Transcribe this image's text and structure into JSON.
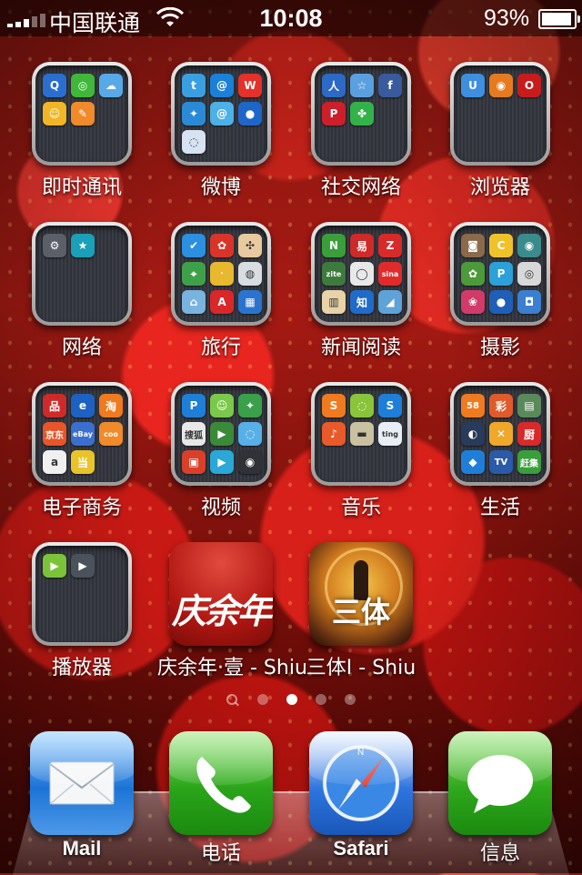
{
  "status_bar": {
    "carrier": "中国联通",
    "time": "10:08",
    "battery_percent": "93",
    "battery_pct_symbol": "%",
    "battery_level": 0.93
  },
  "folders": [
    {
      "label": "即时通讯",
      "icons": [
        {
          "name": "qq-icon",
          "glyph": "Q",
          "color": "#2a6fd0"
        },
        {
          "name": "wechat-icon",
          "glyph": "◎",
          "color": "#3fb83a"
        },
        {
          "name": "cloud-icon",
          "glyph": "☁",
          "color": "#58a9e8"
        },
        {
          "name": "chat-bubble-icon",
          "glyph": "☺",
          "color": "#f2b526"
        },
        {
          "name": "fetion-icon",
          "glyph": "✎",
          "color": "#f08a2a"
        }
      ]
    },
    {
      "label": "微博",
      "icons": [
        {
          "name": "twitter-icon",
          "glyph": "t",
          "color": "#3a9fe0"
        },
        {
          "name": "weibo-spiral-icon",
          "glyph": "@",
          "color": "#1b80d8"
        },
        {
          "name": "sina-weibo-icon",
          "glyph": "W",
          "color": "#e5312a"
        },
        {
          "name": "bird-icon",
          "glyph": "✦",
          "color": "#2b8ad6"
        },
        {
          "name": "at-icon",
          "glyph": "@",
          "color": "#4db0e8"
        },
        {
          "name": "blue-bird-icon",
          "glyph": "●",
          "color": "#1f66c9"
        },
        {
          "name": "bubble-icon",
          "glyph": "◌",
          "color": "#d7e2f2"
        }
      ]
    },
    {
      "label": "社交网络",
      "icons": [
        {
          "name": "renren-icon",
          "glyph": "人",
          "color": "#2d69c6"
        },
        {
          "name": "kaixin-icon",
          "glyph": "☆",
          "color": "#5aa0e0"
        },
        {
          "name": "facebook-icon",
          "glyph": "f",
          "color": "#3a5a9e"
        },
        {
          "name": "pinterest-icon",
          "glyph": "P",
          "color": "#cc1f2a"
        },
        {
          "name": "clover-icon",
          "glyph": "✤",
          "color": "#33b24a"
        }
      ]
    },
    {
      "label": "浏览器",
      "icons": [
        {
          "name": "uc-browser-icon",
          "glyph": "U",
          "color": "#3f8fe0"
        },
        {
          "name": "firefox-icon",
          "glyph": "◉",
          "color": "#e57a1f"
        },
        {
          "name": "opera-icon",
          "glyph": "O",
          "color": "#c81c1c"
        }
      ]
    },
    {
      "label": "网络",
      "icons": [
        {
          "name": "settings-icon",
          "glyph": "⚙",
          "color": "#5a5f68"
        },
        {
          "name": "star-app-icon",
          "glyph": "★",
          "color": "#1aa0b8"
        }
      ]
    },
    {
      "label": "旅行",
      "icons": [
        {
          "name": "checkin-icon",
          "glyph": "✔",
          "color": "#2c8fe0"
        },
        {
          "name": "ladybug-icon",
          "glyph": "✿",
          "color": "#d9342a"
        },
        {
          "name": "compass-icon",
          "glyph": "✣",
          "color": "#e8c9a0"
        },
        {
          "name": "map-pin-icon",
          "glyph": "⌖",
          "color": "#3fa04a"
        },
        {
          "name": "people-icon",
          "glyph": "ᐧ",
          "color": "#e8b830"
        },
        {
          "name": "elephant-icon",
          "glyph": "◍",
          "color": "#d8dde2"
        },
        {
          "name": "maps-icon",
          "glyph": "⌂",
          "color": "#79b3e0"
        },
        {
          "name": "alipay-a-icon",
          "glyph": "A",
          "color": "#d9282a"
        },
        {
          "name": "grid-app-icon",
          "glyph": "▦",
          "color": "#2a74d0"
        }
      ]
    },
    {
      "label": "新闻阅读",
      "icons": [
        {
          "name": "news-n-icon",
          "glyph": "N",
          "color": "#3a9e3a"
        },
        {
          "name": "netease-icon",
          "glyph": "易",
          "color": "#cf2a2a"
        },
        {
          "name": "zaker-icon",
          "glyph": "Z",
          "color": "#d92a2a"
        },
        {
          "name": "zite-icon",
          "glyph": "zite",
          "color": "#3e7a3e"
        },
        {
          "name": "sohu-icon",
          "glyph": "◯",
          "color": "#e8e8e8"
        },
        {
          "name": "sina-news-icon",
          "glyph": "sina",
          "color": "#e12b2b"
        },
        {
          "name": "book-icon",
          "glyph": "▥",
          "color": "#e8d2a8"
        },
        {
          "name": "zhihu-icon",
          "glyph": "知",
          "color": "#1f6bc9"
        },
        {
          "name": "shark-icon",
          "glyph": "◢",
          "color": "#5ea3d8"
        }
      ]
    },
    {
      "label": "摄影",
      "icons": [
        {
          "name": "instagram-icon",
          "glyph": "◙",
          "color": "#8a6a4a"
        },
        {
          "name": "paint-icon",
          "glyph": "C",
          "color": "#f0c22a"
        },
        {
          "name": "lens-icon",
          "glyph": "◉",
          "color": "#3a8c8c"
        },
        {
          "name": "flower-icon",
          "glyph": "✿",
          "color": "#4c9a3a"
        },
        {
          "name": "p-camera-icon",
          "glyph": "P",
          "color": "#2ca0d8"
        },
        {
          "name": "camera-icon",
          "glyph": "◎",
          "color": "#d8d8d8"
        },
        {
          "name": "petals-icon",
          "glyph": "❀",
          "color": "#d23a6a"
        },
        {
          "name": "video-camera-icon",
          "glyph": "●",
          "color": "#1f5fb8"
        },
        {
          "name": "snapshot-icon",
          "glyph": "◘",
          "color": "#3a7fd0"
        }
      ]
    },
    {
      "label": "电子商务",
      "icons": [
        {
          "name": "fengyu-icon",
          "glyph": "品",
          "color": "#cf2a2a"
        },
        {
          "name": "e-icon",
          "glyph": "e",
          "color": "#1d62c2"
        },
        {
          "name": "taobao-icon",
          "glyph": "淘",
          "color": "#f07a1f"
        },
        {
          "name": "jingdong-icon",
          "glyph": "京东",
          "color": "#e8552a"
        },
        {
          "name": "ebay-icon",
          "glyph": "eBay",
          "color": "#3a6fd0"
        },
        {
          "name": "coo-icon",
          "glyph": "coo",
          "color": "#f08a2a"
        },
        {
          "name": "amazon-icon",
          "glyph": "a",
          "color": "#f0f0f0"
        },
        {
          "name": "dangdang-icon",
          "glyph": "当",
          "color": "#e8c42a"
        }
      ]
    },
    {
      "label": "视频",
      "icons": [
        {
          "name": "p-video-icon",
          "glyph": "P",
          "color": "#1f7fd8"
        },
        {
          "name": "face-icon",
          "glyph": "☺",
          "color": "#7ac94a"
        },
        {
          "name": "shou-icon",
          "glyph": "✦",
          "color": "#3aa04a"
        },
        {
          "name": "sohu-video-icon",
          "glyph": "搜狐",
          "color": "#e8e8e8"
        },
        {
          "name": "play-green-icon",
          "glyph": "▶",
          "color": "#3a8a3a"
        },
        {
          "name": "globe-video-icon",
          "glyph": "◌",
          "color": "#58b0e8"
        },
        {
          "name": "tv-icon",
          "glyph": "▣",
          "color": "#d8402a"
        },
        {
          "name": "play-blue-icon",
          "glyph": "▶",
          "color": "#2aa8d8"
        },
        {
          "name": "film-icon",
          "glyph": "◉",
          "color": "#303238"
        }
      ]
    },
    {
      "label": "音乐",
      "icons": [
        {
          "name": "orange-s-icon",
          "glyph": "S",
          "color": "#f07a1f"
        },
        {
          "name": "tea-icon",
          "glyph": "◌",
          "color": "#8ac43a"
        },
        {
          "name": "shazam-icon",
          "glyph": "S",
          "color": "#1f7fd8"
        },
        {
          "name": "guitar-icon",
          "glyph": "♪",
          "color": "#e85a2a"
        },
        {
          "name": "radio-icon",
          "glyph": "▬",
          "color": "#c9c1a0"
        },
        {
          "name": "ting-icon",
          "glyph": "ting",
          "color": "#e8eef5"
        }
      ]
    },
    {
      "label": "生活",
      "icons": [
        {
          "name": "58-icon",
          "glyph": "58",
          "color": "#f07a1f"
        },
        {
          "name": "lottery-icon",
          "glyph": "彩",
          "color": "#e05a2a"
        },
        {
          "name": "bank-card-icon",
          "glyph": "▤",
          "color": "#5a8a5a"
        },
        {
          "name": "xiaomi-icon",
          "glyph": "◐",
          "color": "#2a3a5a"
        },
        {
          "name": "running-icon",
          "glyph": "✕",
          "color": "#f0a82a"
        },
        {
          "name": "kitchen-icon",
          "glyph": "厨",
          "color": "#d82a2a"
        },
        {
          "name": "car-icon",
          "glyph": "◆",
          "color": "#1f7fd8"
        },
        {
          "name": "tv-blue-icon",
          "glyph": "TV",
          "color": "#2a5aa8"
        },
        {
          "name": "ganji-icon",
          "glyph": "赶集",
          "color": "#3a9e3a"
        }
      ]
    },
    {
      "label": "播放器",
      "icons": [
        {
          "name": "play-green-small-icon",
          "glyph": "▶",
          "color": "#7bc43a"
        },
        {
          "name": "play-dark-icon",
          "glyph": "▶",
          "color": "#4a525c"
        }
      ]
    }
  ],
  "apps": [
    {
      "label": "庆余年·壹 - Shiu",
      "art_text": "庆余年"
    },
    {
      "label": "三体I - Shiu",
      "art_text": "三体"
    }
  ],
  "dock": [
    {
      "label": "Mail"
    },
    {
      "label": "电话"
    },
    {
      "label": "Safari"
    },
    {
      "label": "信息"
    }
  ]
}
